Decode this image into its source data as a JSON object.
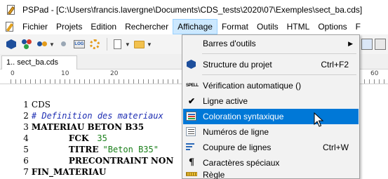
{
  "window": {
    "title": "PSPad - [C:\\Users\\francis.lavergne\\Documents\\CDS_tests\\2020\\07\\Exemples\\sect_ba.cds]"
  },
  "menubar": {
    "items": [
      "Fichier",
      "Projets",
      "Edition",
      "Rechercher",
      "Affichage",
      "Format",
      "Outils",
      "HTML",
      "Options",
      "F"
    ],
    "active": "Affichage"
  },
  "toolbar": {
    "ok_label": "LOG"
  },
  "tabs": [
    {
      "label": "1.. sect_ba.cds"
    }
  ],
  "ruler": {
    "labels": [
      "0",
      "10",
      "20",
      "60"
    ]
  },
  "editor": {
    "lines": [
      {
        "n": "1",
        "text": "CDS"
      },
      {
        "n": "2",
        "text": "# Definition des materiaux"
      },
      {
        "n": "3",
        "text": "MATERIAU BETON B35"
      },
      {
        "n": "4",
        "key": "FCK",
        "val": "35"
      },
      {
        "n": "5",
        "key": "TITRE",
        "val": "\"Beton B35\""
      },
      {
        "n": "6",
        "text": "PRECONTRAINT NON"
      },
      {
        "n": "7",
        "text": "FIN_MATERIAU"
      }
    ]
  },
  "dropdown": {
    "items": [
      {
        "label": "Barres d'outils",
        "shortcut": "",
        "submenu": true,
        "icon": "none"
      },
      {
        "label": "Structure du projet",
        "shortcut": "Ctrl+F2",
        "icon": "project-structure-icon"
      },
      {
        "label": "Vérification automatique ()",
        "shortcut": "",
        "icon": "spell-check-icon",
        "icon_text": "SPELL"
      },
      {
        "label": "Ligne active",
        "shortcut": "",
        "icon": "checkmark-icon",
        "icon_text": "✔"
      },
      {
        "label": "Coloration syntaxique",
        "shortcut": "",
        "icon": "syntax-color-icon",
        "highlighted": true
      },
      {
        "label": "Numéros de ligne",
        "shortcut": "",
        "icon": "line-numbers-icon"
      },
      {
        "label": "Coupure de lignes",
        "shortcut": "Ctrl+W",
        "icon": "word-wrap-icon"
      },
      {
        "label": "Caractères spéciaux",
        "shortcut": "",
        "icon": "pilcrow-icon",
        "icon_text": "¶"
      },
      {
        "label": "Règle",
        "shortcut": "",
        "icon": "ruler-icon"
      }
    ]
  },
  "colors": {
    "menu_highlight": "#0078d7",
    "menu_active_bg": "#cce8ff",
    "comment": "#1f2fb3",
    "value": "#1a7f1a"
  }
}
